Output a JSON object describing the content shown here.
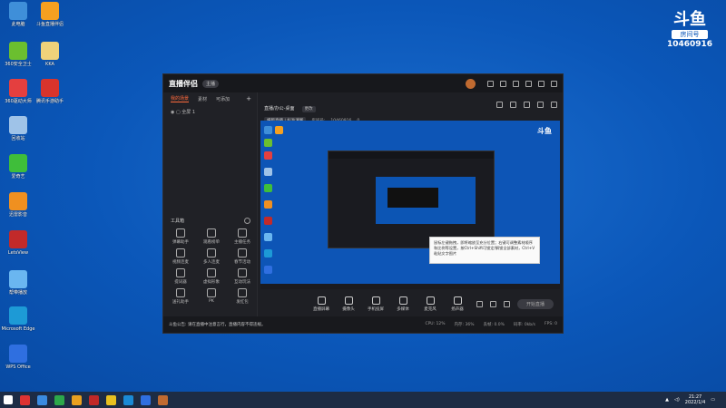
{
  "desktop_icons": [
    {
      "label": "此电脑",
      "color": "#3f8fd9"
    },
    {
      "label": "斗鱼直播伴侣",
      "color": "#f5a020"
    },
    {
      "label": "360安全卫士",
      "color": "#6bbf2f"
    },
    {
      "label": "KKA",
      "color": "#f0d27a"
    },
    {
      "label": "360驱动大师",
      "color": "#e43f3f"
    },
    {
      "label": "腾讯手游助手",
      "color": "#d8342c"
    },
    {
      "label": "回收站",
      "color": "#9fc3e8"
    },
    {
      "label": "爱奇艺",
      "color": "#3fbe3a"
    },
    {
      "label": "迅雷影音",
      "color": "#f09020"
    },
    {
      "label": "LetsView",
      "color": "#c22a2a"
    },
    {
      "label": "帮带播放",
      "color": "#6ab6f0"
    },
    {
      "label": "Microsoft Edge",
      "color": "#1d9ad6"
    },
    {
      "label": "WPS Office",
      "color": "#2f6fe0"
    }
  ],
  "watermark": {
    "logo": "斗鱼",
    "sub": "房间号",
    "room": "10460916"
  },
  "app": {
    "logo": "直播伴侣",
    "badge": "主播",
    "left_tabs": [
      "我的场景",
      "素材",
      "可添加"
    ],
    "scene": "全屏 1",
    "tools_title": "工具箱",
    "tools": [
      "弹幕助手",
      "观看榜单",
      "主播任务",
      "视频连麦",
      "多人连麦",
      "春节活动",
      "提词器",
      "虚拟形象",
      "互动玩法",
      "送礼助手",
      "PK",
      "发红包"
    ],
    "preview": {
      "title": "直播/办公-桌面",
      "tag": "更改",
      "chip": "横版直播 | 标准清晰",
      "room_label": "房间号:",
      "room": "10460916",
      "online": "0"
    },
    "tooltip": "鼠标左键拖拽，即将缩放至充分位置；右键可调整素材顺序和比例等设置，按Ctrl+Shift可锁定/解锁全部素材，Ctrl+V粘贴文字图片",
    "controls": [
      "直播屏幕",
      "摄像头",
      "手机投屏",
      "多媒体",
      "麦克风",
      "扬声器"
    ],
    "start_label": "开始直播",
    "status_notice": "斗鱼公告: 请在直播中注意言行，直播内容不得违规。",
    "status_right": [
      "CPU: 12%",
      "内存: 36%",
      "丢帧: 0.0%",
      "码率: 0kb/s",
      "FPS: 0"
    ]
  },
  "taskbar": {
    "icons": [
      "#d33",
      "#3a8be0",
      "#2ca84a",
      "#e8a020",
      "#c02828",
      "#e8c020",
      "#1a8ad6",
      "#2f6fe0",
      "#c06a30"
    ],
    "time": "21:27",
    "date": "2022/1/4"
  }
}
